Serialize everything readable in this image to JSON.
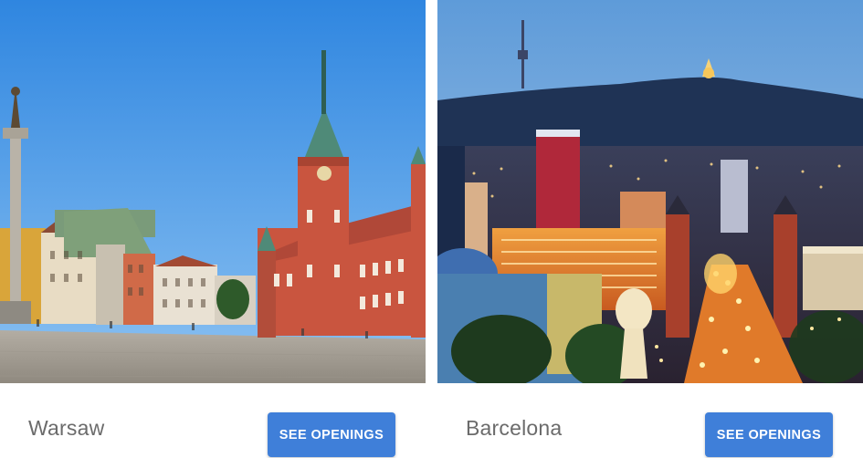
{
  "cards": [
    {
      "city": "Warsaw",
      "button_label": "SEE OPENINGS",
      "image": "warsaw-old-town-castle-square"
    },
    {
      "city": "Barcelona",
      "button_label": "SEE OPENINGS",
      "image": "barcelona-night-skyline"
    }
  ],
  "colors": {
    "button_bg": "#3f7fd9",
    "button_text": "#ffffff",
    "city_text": "#6b6b6b"
  }
}
